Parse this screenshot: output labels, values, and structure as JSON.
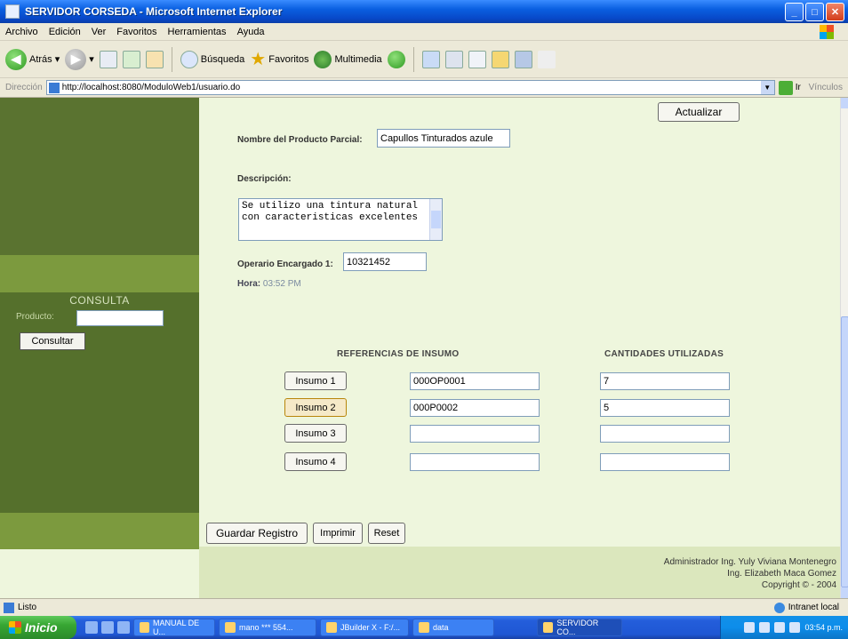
{
  "window": {
    "title": "SERVIDOR CORSEDA - Microsoft Internet Explorer",
    "min": "_",
    "max": "□",
    "close": "✕"
  },
  "menu": [
    "Archivo",
    "Edición",
    "Ver",
    "Favoritos",
    "Herramientas",
    "Ayuda"
  ],
  "toolbar": {
    "back": "Atrás",
    "search": "Búsqueda",
    "favorites": "Favoritos",
    "multimedia": "Multimedia"
  },
  "address": {
    "label": "Dirección",
    "url": "http://localhost:8080/ModuloWeb1/usuario.do",
    "go": "Ir",
    "links": "Vínculos"
  },
  "sidebar": {
    "consulta_title": "CONSULTA",
    "producto_label": "Producto:",
    "producto_value": "",
    "consultar_button": "Consultar"
  },
  "form": {
    "actualizar_button": "Actualizar",
    "nombre_label": "Nombre del Producto Parcial:",
    "nombre_value": "Capullos Tinturados azule",
    "descripcion_label": "Descripción:",
    "descripcion_value": "Se utilizo una tintura natural con caracteristicas excelentes",
    "operario_label": "Operario Encargado 1:",
    "operario_value": "10321452",
    "hora_label": "Hora:",
    "hora_value": "03:52 PM",
    "ref_header": "REFERENCIAS DE INSUMO",
    "cant_header": "CANTIDADES UTILIZADAS",
    "insumos": [
      {
        "label": "Insumo 1",
        "ref": "000OP0001",
        "cant": "7"
      },
      {
        "label": "Insumo 2",
        "ref": "000P0002",
        "cant": "5"
      },
      {
        "label": "Insumo 3",
        "ref": "",
        "cant": ""
      },
      {
        "label": "Insumo 4",
        "ref": "",
        "cant": ""
      }
    ],
    "guardar_button": "Guardar Registro",
    "imprimir_button": "Imprimir",
    "reset_button": "Reset"
  },
  "footer": {
    "line1": "Administrador Ing. Yuly Viviana Montenegro",
    "line2": "Ing. Elizabeth Maca Gomez",
    "line3": "Copyright © - 2004"
  },
  "status": {
    "text": "Listo",
    "zone": "Intranet local"
  },
  "taskbar": {
    "start": "Inicio",
    "tasks": [
      "MANUAL DE U...",
      "mano *** 554...",
      "JBuilder X - F:/...",
      "data",
      "SERVIDOR CO..."
    ],
    "clock": "03:54 p.m."
  }
}
